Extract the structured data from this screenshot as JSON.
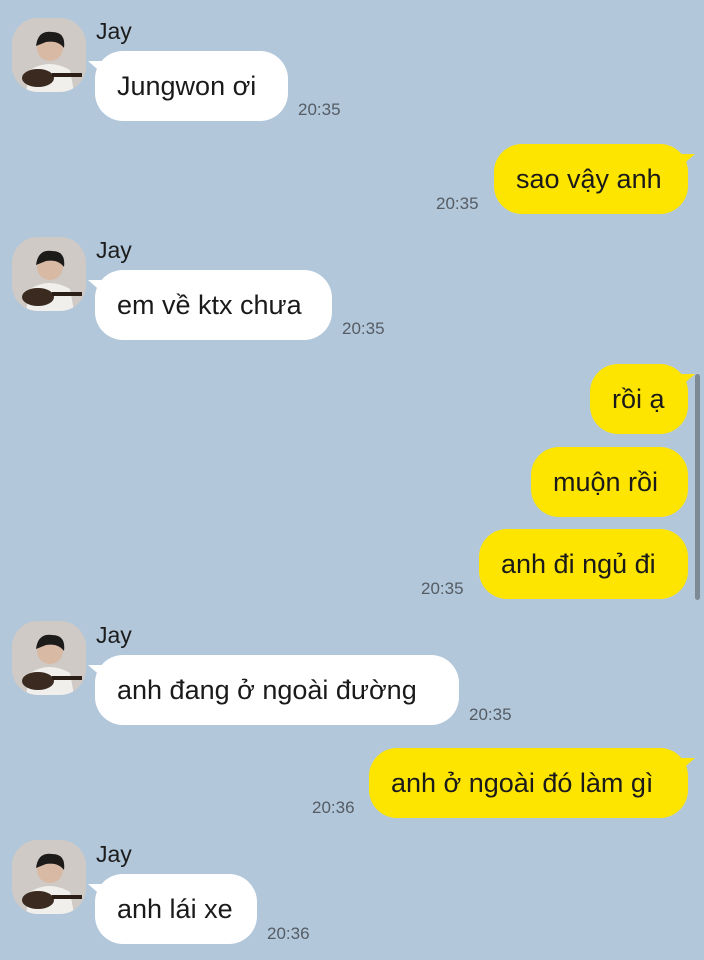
{
  "colors": {
    "background": "#b2c7da",
    "incoming_bubble": "#ffffff",
    "outgoing_bubble": "#fee500"
  },
  "messages": [
    {
      "sender": "Jay",
      "text": "Jungwon ơi",
      "time": "20:35"
    },
    {
      "text": "sao vậy anh",
      "time": "20:35"
    },
    {
      "sender": "Jay",
      "text": "em về ktx chưa",
      "time": "20:35"
    },
    {
      "text": "rồi ạ"
    },
    {
      "text": "muộn rồi"
    },
    {
      "text": "anh đi ngủ đi",
      "time": "20:35"
    },
    {
      "sender": "Jay",
      "text": "anh đang ở ngoài đường",
      "time": "20:35"
    },
    {
      "text": "anh ở ngoài đó làm gì",
      "time": "20:36"
    },
    {
      "sender": "Jay",
      "text": "anh lái xe",
      "time": "20:36"
    }
  ]
}
